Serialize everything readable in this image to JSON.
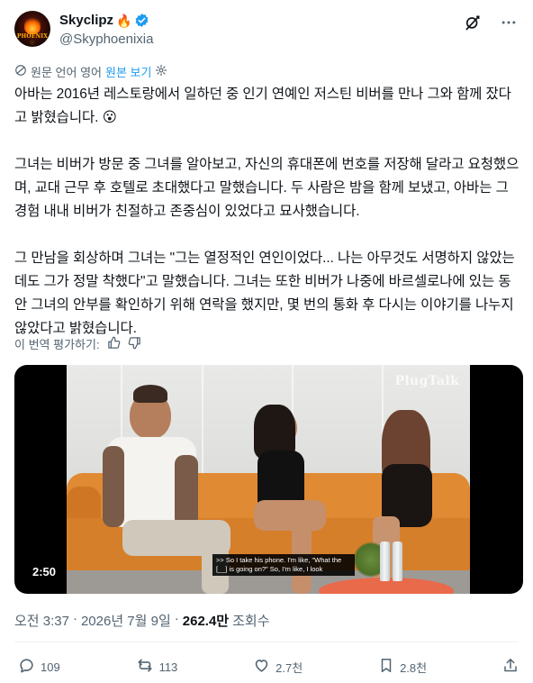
{
  "author": {
    "display_name": "Skyclipz",
    "emoji": "🔥",
    "handle": "@Skyphoenixia",
    "avatar_text": "PHOENIX",
    "avatar_subtext": "ⓒ"
  },
  "translation": {
    "note": "원문 언어 영어",
    "show_original_label": "원본 보기"
  },
  "post": {
    "paragraphs": [
      "아바는 2016년 레스토랑에서 일하던 중 인기 연예인 저스틴 비버를 만나 그와 함께 잤다고 밝혔습니다. 😮",
      "그녀는 비버가 방문 중 그녀를 알아보고, 자신의 휴대폰에 번호를 저장해 달라고 요청했으며, 교대 근무 후 호텔로 초대했다고 말했습니다. 두 사람은 밤을 함께 보냈고, 아바는 그 경험 내내 비버가 친절하고 존중심이 있었다고 묘사했습니다.",
      "그 만남을 회상하며 그녀는 \"그는 열정적인 연인이었다... 나는 아무것도 서명하지 않았는데도 그가 정말 착했다\"고 말했습니다. 그녀는 또한 비버가 나중에 바르셀로나에 있는 동안 그녀의 안부를 확인하기 위해 연락을 했지만, 몇 번의 통화 후 다시는 이야기를 나누지 않았다고 밝혔습니다."
    ]
  },
  "rate_translation": {
    "label": "이 번역 평가하기:"
  },
  "media": {
    "duration": "2:50",
    "watermark": "PlugTalk",
    "caption": ">> So I take his phone. I'm like, \"What the [__] is going on?\" So, I'm like, I look"
  },
  "meta": {
    "time": "오전 3:37",
    "separator": "·",
    "date": "2026년 7월 9일",
    "views_count": "262.4만",
    "views_label": "조회수"
  },
  "actions": {
    "replies": "109",
    "reposts": "113",
    "likes": "2.7천",
    "bookmarks": "2.8천"
  },
  "colors": {
    "accent": "#1d9bf0",
    "secondary_text": "#536471",
    "sofa": "#e08a34"
  }
}
